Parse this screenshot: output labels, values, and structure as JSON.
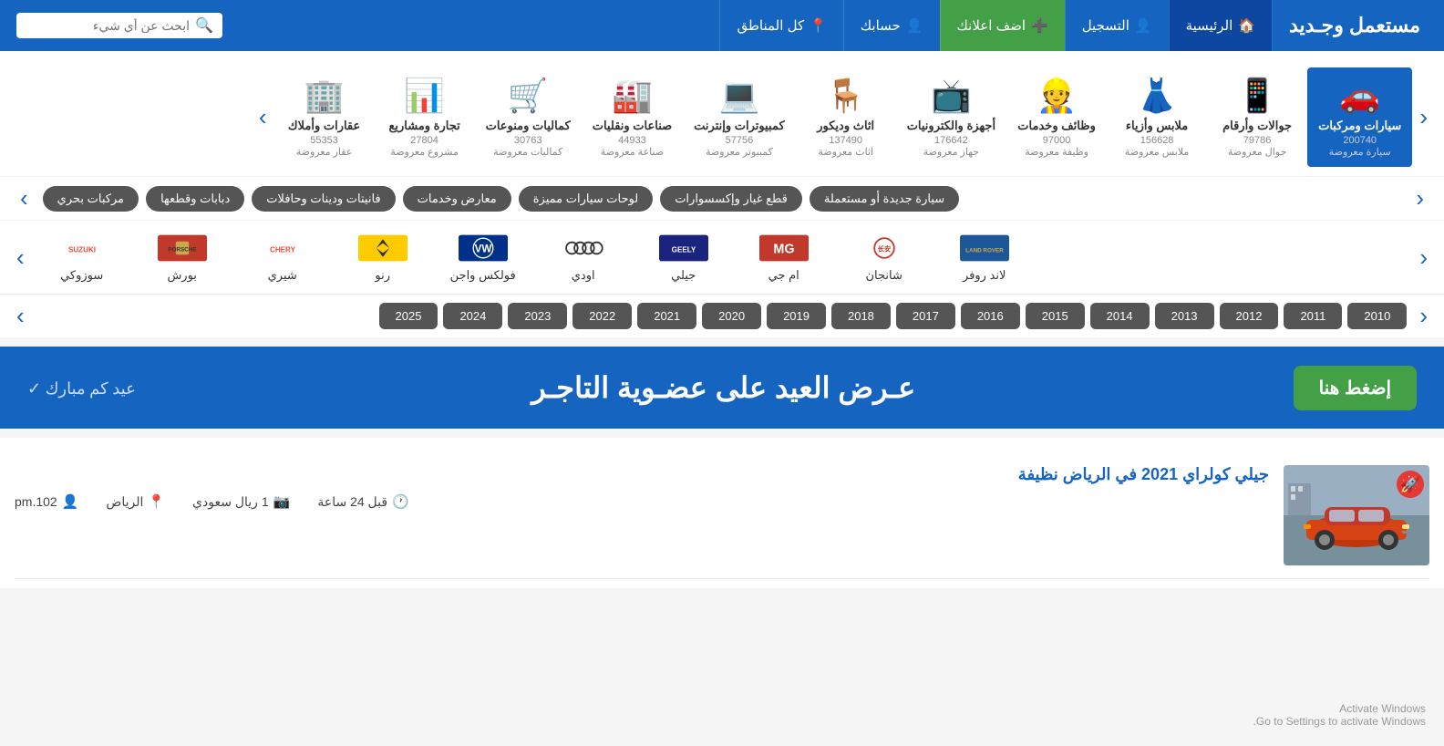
{
  "header": {
    "logo": "مستعمل وجـديد",
    "nav": [
      {
        "id": "home",
        "label": "الرئيسية",
        "icon": "🏠"
      },
      {
        "id": "register",
        "label": "التسجيل",
        "icon": "👤"
      },
      {
        "id": "add-ad",
        "label": "اضف اعلانك",
        "icon": "➕",
        "style": "green"
      },
      {
        "id": "account",
        "label": "حسابك",
        "icon": "👤"
      },
      {
        "id": "regions",
        "label": "كل المناطق",
        "icon": "📍"
      }
    ],
    "search_placeholder": "ابحث عن أي شيء"
  },
  "categories": [
    {
      "id": "cars",
      "icon": "🚗",
      "name": "سيارات\nومركبات",
      "count": "200740",
      "count_label": "سيارة معروضة",
      "selected": true
    },
    {
      "id": "phones",
      "icon": "📱",
      "name": "جوالات\nوأرقام",
      "count": "79786",
      "count_label": "جوال معروضة"
    },
    {
      "id": "clothes",
      "icon": "👗",
      "name": "ملابس\nوأزياء",
      "count": "156628",
      "count_label": "ملابس معروضة"
    },
    {
      "id": "jobs",
      "icon": "👷",
      "name": "وظائف\nوخدمات",
      "count": "97000",
      "count_label": "وظيفة معروضة"
    },
    {
      "id": "electronics",
      "icon": "📺",
      "name": "أجهزة\nوالكترونيات",
      "count": "176642",
      "count_label": "جهاز معروضة"
    },
    {
      "id": "furniture",
      "icon": "🪑",
      "name": "اثاث\nوديكور",
      "count": "137490",
      "count_label": "اثاث معروضة"
    },
    {
      "id": "computers",
      "icon": "💻",
      "name": "كمبيوترات\nوإنترنت",
      "count": "57756",
      "count_label": "كمبيوتر معروضة"
    },
    {
      "id": "factories",
      "icon": "🏭",
      "name": "صناعات\nونقليات",
      "count": "44933",
      "count_label": "صناعة معروضة"
    },
    {
      "id": "accessories",
      "icon": "🛒",
      "name": "كماليات\nومنوعات",
      "count": "30763",
      "count_label": "كماليات معروضة"
    },
    {
      "id": "trade",
      "icon": "📊",
      "name": "تجارة\nومشاريع",
      "count": "27804",
      "count_label": "مشروع معروضة"
    },
    {
      "id": "realestate",
      "icon": "🏢",
      "name": "عقارات\nوأملاك",
      "count": "55353",
      "count_label": "عقار معروضة"
    }
  ],
  "sub_tags": [
    "سيارة جديدة أو مستعملة",
    "قطع غيار وإكسسوارات",
    "لوحات سيارات مميزة",
    "معارض وخدمات",
    "فانيتات ودينات وحافلات",
    "دبابات وقطعها",
    "مركبات بحري"
  ],
  "brands": [
    {
      "id": "land-rover",
      "name": "لاند روفر",
      "color": "#1e5799"
    },
    {
      "id": "changan",
      "name": "شانجان",
      "color": "#c0392b"
    },
    {
      "id": "mg",
      "name": "ام جي",
      "color": "#c0392b"
    },
    {
      "id": "geely",
      "name": "جيلي",
      "color": "#2980b9"
    },
    {
      "id": "audi",
      "name": "اودي",
      "color": "#333"
    },
    {
      "id": "volkswagen",
      "name": "فولكس واجن",
      "color": "#003087"
    },
    {
      "id": "renault",
      "name": "رنو",
      "color": "#ffcc00"
    },
    {
      "id": "chery",
      "name": "شيري",
      "color": "#e74c3c"
    },
    {
      "id": "porsche",
      "name": "بورش",
      "color": "#c0392b"
    },
    {
      "id": "suzuki",
      "name": "سوزوكي",
      "color": "#e74c3c"
    }
  ],
  "years": [
    "2010",
    "2011",
    "2012",
    "2013",
    "2014",
    "2015",
    "2016",
    "2017",
    "2018",
    "2019",
    "2020",
    "2021",
    "2022",
    "2023",
    "2024",
    "2025"
  ],
  "promo": {
    "text": "عـرض العيد على عضـوية التاجـر",
    "button_label": "إضغط هنا",
    "signature": "عيد كم مبارك"
  },
  "listings": [
    {
      "title": "جيلي كولراي 2021 في الرياض نظيفة",
      "price": "1 ريال سعودي",
      "location": "الرياض",
      "time": "قبل 24 ساعة",
      "user": "pm.102",
      "boosted": true
    }
  ],
  "windows_watermark": {
    "line1": "Activate Windows",
    "line2": "Go to Settings to activate Windows."
  }
}
